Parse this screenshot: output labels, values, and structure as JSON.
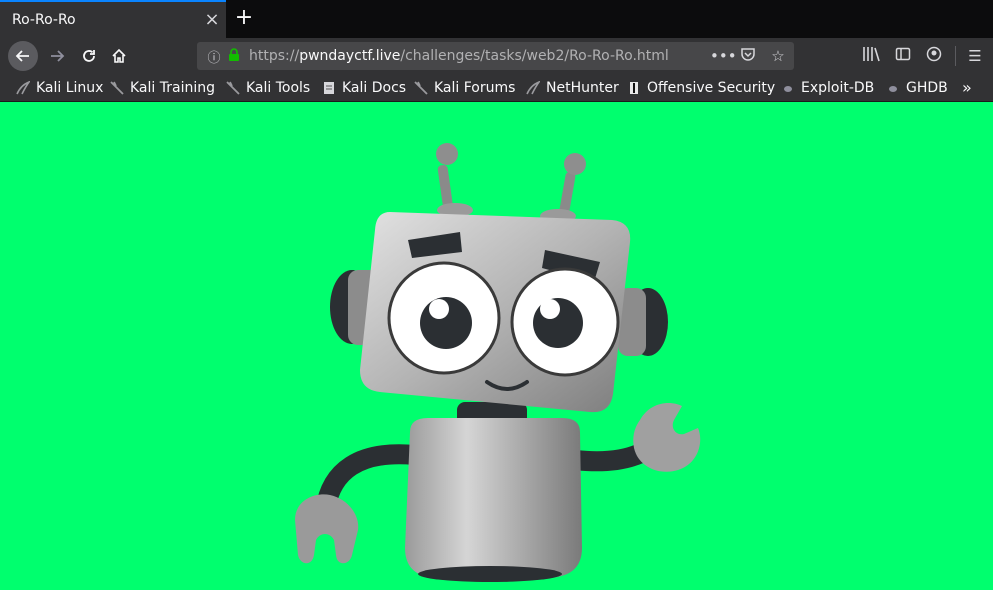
{
  "browser": {
    "tab_title": "Ro-Ro-Ro",
    "tab_close": "×",
    "new_tab": "+",
    "url_scheme": "https://",
    "url_host": "pwndayctf.live",
    "url_path": "/challenges/tasks/web2/Ro-Ro-Ro.html",
    "page_actions": "•••"
  },
  "bookmarks": [
    {
      "label": "Kali Linux",
      "icon": "kali-dragon-icon"
    },
    {
      "label": "Kali Training",
      "icon": "kali-dragon-icon"
    },
    {
      "label": "Kali Tools",
      "icon": "kali-dragon-icon"
    },
    {
      "label": "Kali Docs",
      "icon": "doc-icon"
    },
    {
      "label": "Kali Forums",
      "icon": "kali-dragon-icon"
    },
    {
      "label": "NetHunter",
      "icon": "kali-dragon-icon"
    },
    {
      "label": "Offensive Security",
      "icon": "offsec-icon"
    },
    {
      "label": "Exploit-DB",
      "icon": "bug-icon"
    },
    {
      "label": "GHDB",
      "icon": "bug-icon"
    }
  ],
  "page": {
    "background": "#00ff6e",
    "image": "cartoon-robot"
  },
  "colors": {
    "tab_accent": "#0a84ff",
    "toolbar": "#323234",
    "lock": "#12bc00"
  }
}
